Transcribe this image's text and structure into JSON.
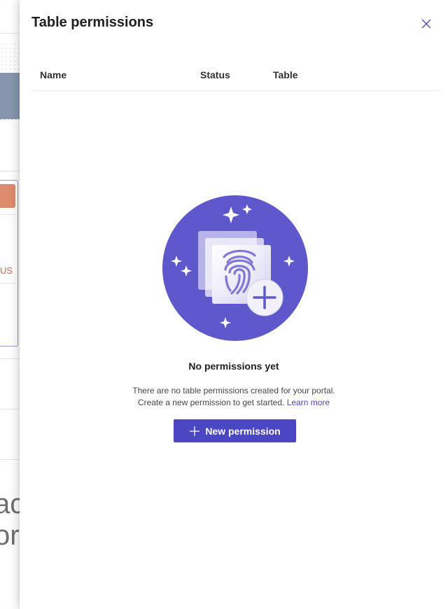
{
  "panel": {
    "title": "Table permissions",
    "close_icon": "close-icon"
  },
  "table": {
    "columns": [
      "Name",
      "Status",
      "Table"
    ]
  },
  "empty_state": {
    "illustration_icon": "fingerprint-add-icon",
    "title": "No permissions yet",
    "description_line1": "There are no table permissions created for your portal.",
    "description_line2": "Create a new permission to get started.",
    "learn_more": "Learn more"
  },
  "actions": {
    "new_permission_label": "New permission",
    "new_permission_icon": "plus-icon"
  },
  "background": {
    "snippet_text": "US",
    "big_text_1": "ac",
    "big_text_2": "or"
  },
  "colors": {
    "accent": "#4b46c4",
    "illustration_circle": "#5f58cc",
    "link": "#4f46c8"
  }
}
